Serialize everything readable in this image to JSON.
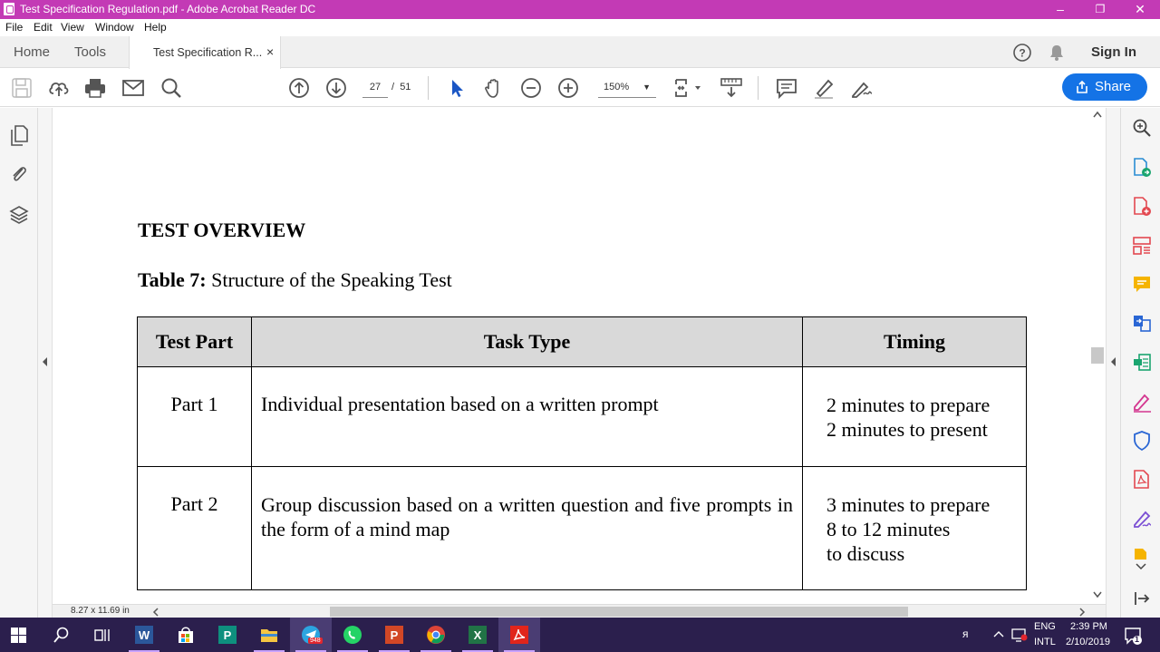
{
  "window": {
    "title": "Test Specification Regulation.pdf - Adobe Acrobat Reader DC",
    "controls": {
      "minimize": "–",
      "restore": "❐",
      "close": "✕"
    }
  },
  "menu": [
    "File",
    "Edit",
    "View",
    "Window",
    "Help"
  ],
  "tabs": {
    "home": "Home",
    "tools": "Tools",
    "document": "Test Specification R...",
    "close": "×",
    "sign_in": "Sign In"
  },
  "toolbar": {
    "page_current": "27",
    "page_separator": "/",
    "page_total": "51",
    "zoom": "150%",
    "share": "Share"
  },
  "status": {
    "page_size": "8.27 x 11.69 in"
  },
  "document": {
    "heading": "TEST OVERVIEW",
    "caption_bold": "Table 7:",
    "caption_text": " Structure of the Speaking Test",
    "table": {
      "headers": [
        "Test Part",
        "Task Type",
        "Timing"
      ],
      "rows": [
        {
          "part": "Part 1",
          "task": "Individual presentation based on a written prompt",
          "timing": [
            "2 minutes to prepare",
            "2 minutes to present"
          ]
        },
        {
          "part": "Part 2",
          "task": "Group discussion based on a written question and five prompts in the form of a mind map",
          "timing": [
            "3 minutes to prepare",
            "8 to 12 minutes",
            "to discuss"
          ]
        }
      ]
    }
  },
  "taskbar": {
    "telegram_badge": "948",
    "lang_top": "ENG",
    "lang_bottom": "INTL",
    "time": "2:39 PM",
    "date": "2/10/2019",
    "notification_count": "1"
  },
  "colors": {
    "titlebar": "#c33ab5",
    "share_button": "#1473e6",
    "taskbar": "#2b1f4d",
    "table_header": "#d9d9d9"
  }
}
